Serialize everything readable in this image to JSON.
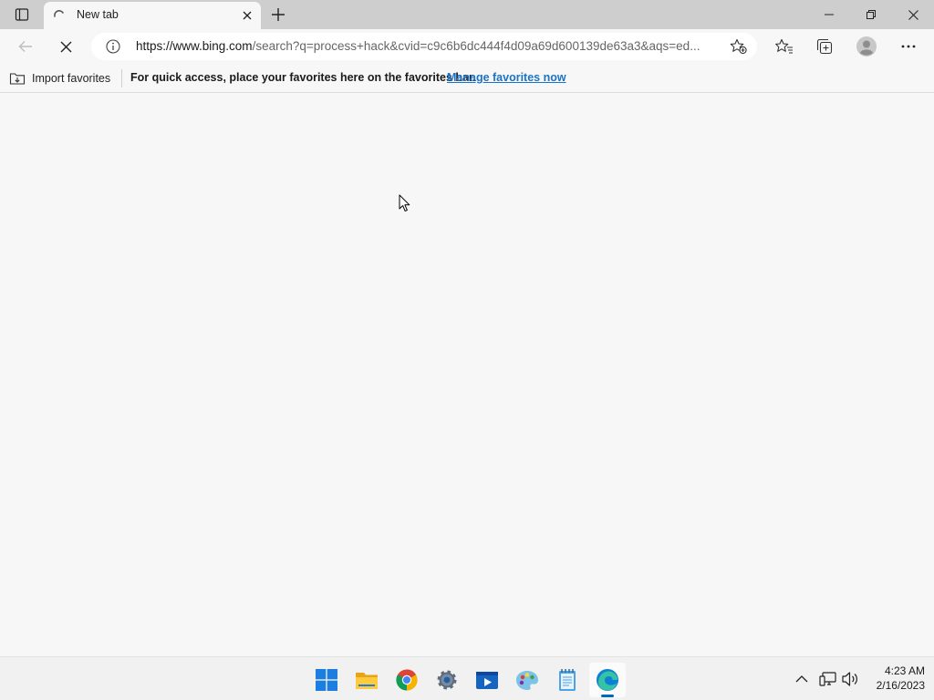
{
  "tab": {
    "title": "New tab"
  },
  "toolbar": {
    "url_host": "https://www.bing.com",
    "url_rest": "/search?q=process+hack&cvid=c9c6b6dc444f4d09a69d600139de63a3&aqs=ed..."
  },
  "favorites_bar": {
    "import_label": "Import favorites",
    "message": "For quick access, place your favorites here on the favorites bar.",
    "manage_link": "Manage favorites now"
  },
  "taskbar": {
    "apps": [
      "start",
      "file-explorer",
      "chrome",
      "settings",
      "media-player",
      "paint",
      "notepad",
      "edge"
    ],
    "active_app": "edge",
    "clock": {
      "time": "4:23 AM",
      "date": "2/16/2023"
    }
  },
  "colors": {
    "tabstrip": "#cecece",
    "surface": "#f7f7f7",
    "link": "#1a73c7",
    "accent": "#0067c0"
  }
}
